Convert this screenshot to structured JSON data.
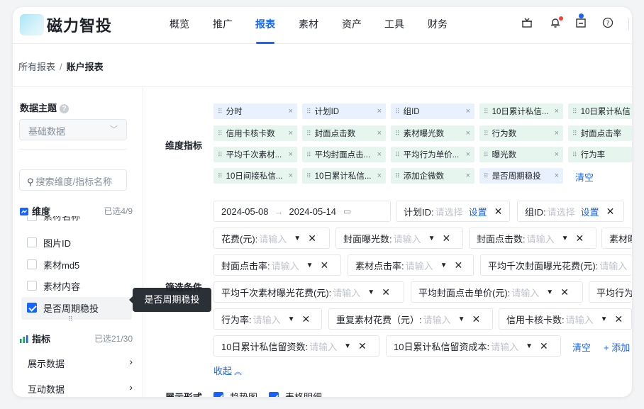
{
  "app": {
    "logo_text": "磁力智投"
  },
  "nav": {
    "tabs": [
      {
        "label": "概览"
      },
      {
        "label": "推广"
      },
      {
        "label": "报表"
      },
      {
        "label": "素材"
      },
      {
        "label": "资产"
      },
      {
        "label": "工具"
      },
      {
        "label": "财务"
      }
    ],
    "help_glyph": "?"
  },
  "breadcrumb": {
    "parent": "所有报表",
    "separator": "/",
    "current": "账户报表"
  },
  "sidebar": {
    "title": "数据主题",
    "theme_select": {
      "value": "基础数据"
    },
    "search": {
      "placeholder": "搜索维度/指标名称"
    },
    "dimension_group": {
      "label": "维度",
      "count": "已选4/9"
    },
    "clipped_item": "素材名称",
    "items": [
      {
        "label": "图片ID",
        "checked": false
      },
      {
        "label": "素材md5",
        "checked": false
      },
      {
        "label": "素材内容",
        "checked": false
      },
      {
        "label": "是否周期稳投",
        "checked": true
      }
    ],
    "metric_group": {
      "label": "指标",
      "count": "已选21/30"
    },
    "links": [
      {
        "label": "展示数据"
      },
      {
        "label": "互动数据"
      }
    ],
    "tooltip": "是否周期稳投"
  },
  "main": {
    "dimension_label": "维度指标",
    "chips": [
      {
        "label": "分时",
        "color": "blue"
      },
      {
        "label": "计划ID",
        "color": "blue"
      },
      {
        "label": "组ID",
        "color": "blue"
      },
      {
        "label": "10日累计私信...",
        "color": "green"
      },
      {
        "label": "10日累计私信",
        "color": "green"
      },
      {
        "label": "信用卡核卡数",
        "color": "green"
      },
      {
        "label": "封面点击数",
        "color": "green"
      },
      {
        "label": "素材曝光数",
        "color": "green"
      },
      {
        "label": "行为数",
        "color": "green"
      },
      {
        "label": "封面点击率",
        "color": "green"
      },
      {
        "label": "平均千次素材...",
        "color": "green"
      },
      {
        "label": "平均封面点击...",
        "color": "green"
      },
      {
        "label": "平均行为单价...",
        "color": "green"
      },
      {
        "label": "曝光数",
        "color": "green"
      },
      {
        "label": "行为率",
        "color": "green"
      },
      {
        "label": "10日间接私信...",
        "color": "green"
      },
      {
        "label": "10日累计私信...",
        "color": "green"
      },
      {
        "label": "添加企微数",
        "color": "green"
      },
      {
        "label": "是否周期稳投",
        "color": "blue"
      }
    ],
    "clear_label": "清空",
    "filter_label": "筛选条件",
    "date_range": {
      "start": "2024-05-08",
      "arrow": "→",
      "end": "2024-05-14"
    },
    "plan_filter": {
      "label": "计划ID:",
      "placeholder": "请选择",
      "action": "设置"
    },
    "group_filter": {
      "label": "组ID:",
      "placeholder": "请选择",
      "action": "设置"
    },
    "placeholder": "请输入",
    "filters": [
      {
        "label": "花费(元):"
      },
      {
        "label": "封面曝光数:"
      },
      {
        "label": "封面点击数:"
      },
      {
        "label": "素材曝"
      },
      {
        "label": "封面点击率:"
      },
      {
        "label": "素材点击率:"
      },
      {
        "label": "平均千次封面曝光花费(元):"
      },
      {
        "label": "平均千次素材曝光花费(元):"
      },
      {
        "label": "平均封面点击单价(元):"
      },
      {
        "label": "平均行为"
      },
      {
        "label": "行为率:"
      },
      {
        "label": "重复素材花费（元）:"
      },
      {
        "label": "信用卡核卡数:"
      },
      {
        "label": "10日累计私信留资数:"
      },
      {
        "label": "10日累计私信留资成本:"
      }
    ],
    "filter_clear": "清空",
    "filter_add": "+ 添加",
    "collapse": "收起",
    "display_label": "展示形式",
    "display_options": [
      {
        "label": "趋势图",
        "checked": true
      },
      {
        "label": "表格明细",
        "checked": true
      }
    ]
  },
  "colors": {
    "accent": "#1664ff",
    "chip_blue": "#e8f1fd",
    "chip_green": "#e6f6ee"
  }
}
